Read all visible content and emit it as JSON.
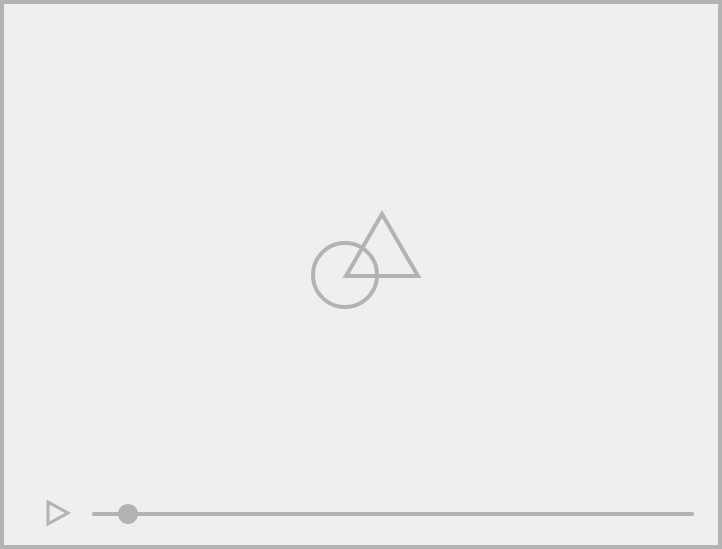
{
  "player": {
    "placeholder_icon": "image-placeholder-icon",
    "play_icon": "play-icon",
    "progress": 0.06,
    "colors": {
      "background": "#efefef",
      "border": "#b3b3b3",
      "icon": "#b3b3b3"
    }
  }
}
